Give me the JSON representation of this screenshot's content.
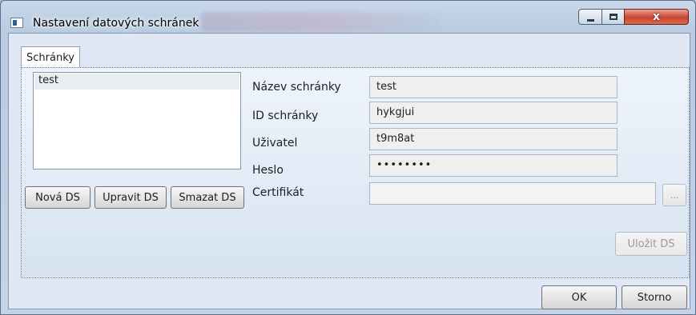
{
  "window": {
    "title": "Nastavení datových schránek",
    "close_glyph": "x",
    "icons": [
      "window-icon",
      "minimize-icon",
      "maximize-icon",
      "close-icon"
    ]
  },
  "tab": {
    "label": "Schránky"
  },
  "list": {
    "items": [
      "test"
    ]
  },
  "list_buttons": {
    "new": "Nová DS",
    "edit": "Upravit DS",
    "delete": "Smazat DS"
  },
  "form": {
    "name_label": "Název schránky",
    "name_value": "test",
    "id_label": "ID schránky",
    "id_value": "hykgjui",
    "user_label": "Uživatel",
    "user_value": "t9m8at",
    "password_label": "Heslo",
    "password_value": "••••••••",
    "cert_label": "Certifikát",
    "cert_value": "",
    "browse_label": "...",
    "save_label": "Uložit DS"
  },
  "footer": {
    "ok_label": "OK",
    "cancel_label": "Storno"
  },
  "colors": {
    "close_button": "#c9452f",
    "chrome": "#c4d4e8",
    "panel": "#dfe8f4"
  }
}
